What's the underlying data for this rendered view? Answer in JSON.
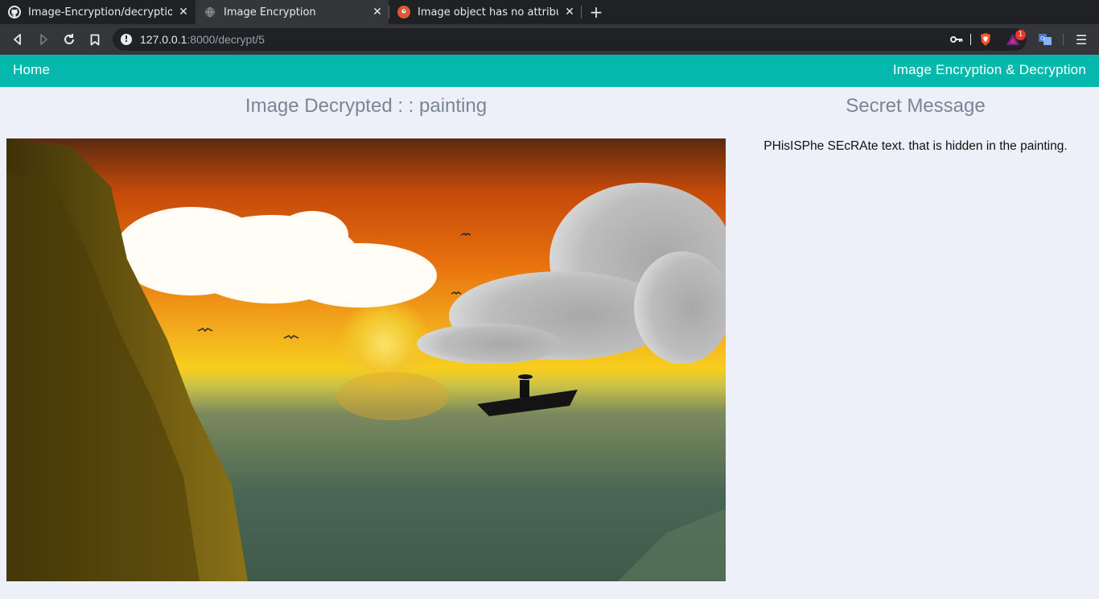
{
  "browser": {
    "tabs": [
      {
        "title": "Image-Encryption/decryptio",
        "icon": "github-icon",
        "active": false
      },
      {
        "title": "Image Encryption",
        "icon": "globe-icon",
        "active": true
      },
      {
        "title": "Image object has no attribut",
        "icon": "duckduckgo-icon",
        "active": false
      }
    ],
    "new_tab_label": "+",
    "close_label": "✕",
    "url_host": "127.0.0.1",
    "url_rest": ":8000/decrypt/5",
    "extension_badge": "1",
    "menu_label": "☰"
  },
  "navbar": {
    "home_label": "Home",
    "brand_label": "Image Encryption & Decryption",
    "color": "#05b8ad"
  },
  "main": {
    "heading": "Image Decrypted : : painting",
    "image_alt": "painting"
  },
  "sidebar": {
    "heading": "Secret Message",
    "message": "PHisISPhe SEcRAte text. that is hidden in the painting."
  }
}
